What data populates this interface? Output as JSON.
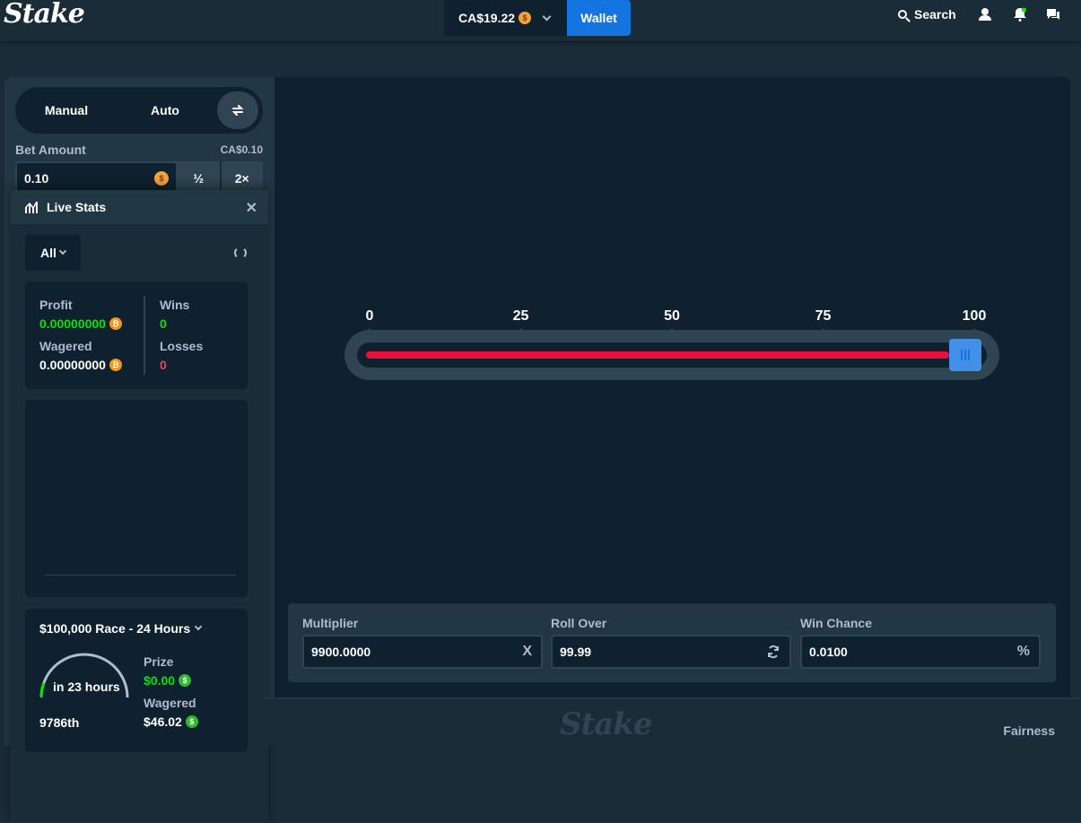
{
  "header": {
    "logo": "Stake",
    "balance": "CA$19.22",
    "currency_symbol": "$",
    "wallet_label": "Wallet",
    "search_label": "Search"
  },
  "betpanel": {
    "tab_manual": "Manual",
    "tab_auto": "Auto",
    "bet_amount_label": "Bet Amount",
    "bet_amount_fiat": "CA$0.10",
    "bet_amount_value": "0.10",
    "half_label": "½",
    "double_label": "2×"
  },
  "livestats": {
    "title": "Live Stats",
    "filter": "All",
    "profit_label": "Profit",
    "profit_value": "0.00000000",
    "wagered_label": "Wagered",
    "wagered_value": "0.00000000",
    "wins_label": "Wins",
    "wins_value": "0",
    "losses_label": "Losses",
    "losses_value": "0",
    "crypto_symbol": "₿"
  },
  "race": {
    "title": "$100,000 Race - 24 Hours",
    "gauge_text": "in 23 hours",
    "rank": "9786th",
    "prize_label": "Prize",
    "prize_value": "$0.00",
    "wagered_label": "Wagered",
    "wagered_value": "$46.02",
    "usd_symbol": "$"
  },
  "slider": {
    "ticks": [
      "0",
      "25",
      "50",
      "75",
      "100"
    ],
    "value": 99.99
  },
  "controls": {
    "multiplier_label": "Multiplier",
    "multiplier_value": "9900.0000",
    "multiplier_suffix": "X",
    "rollover_label": "Roll Over",
    "rollover_value": "99.99",
    "winchance_label": "Win Chance",
    "winchance_value": "0.0100",
    "winchance_suffix": "%"
  },
  "footer": {
    "logo": "Stake",
    "fairness_label": "Fairness"
  },
  "colors": {
    "accent": "#1475e1",
    "win_green": "#00e701",
    "loss_red": "#ed4163",
    "slider_red": "#e9113c",
    "panel_dark": "#0f212e",
    "panel_mid": "#213743"
  }
}
